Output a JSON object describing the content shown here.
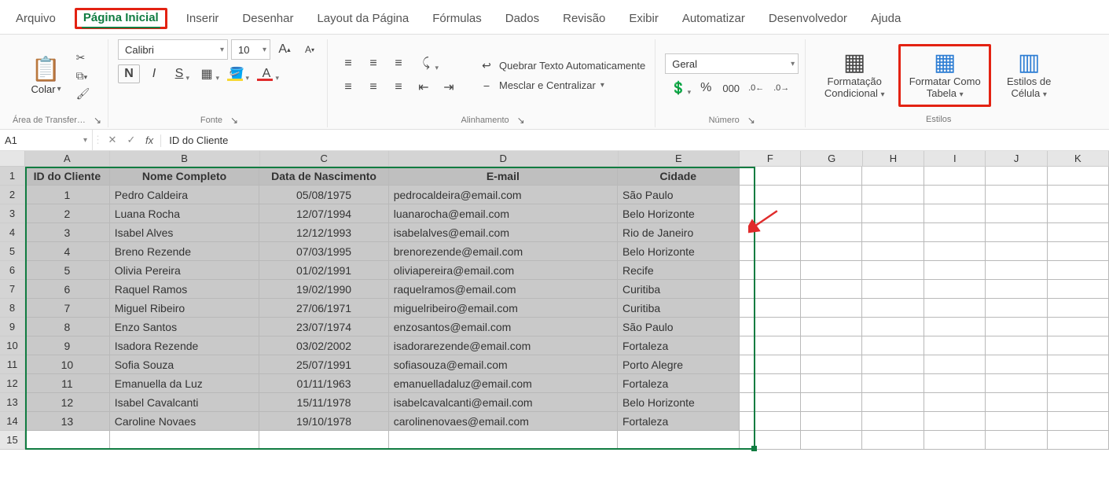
{
  "tabs": {
    "file": "Arquivo",
    "home": "Página Inicial",
    "insert": "Inserir",
    "draw": "Desenhar",
    "pagelayout": "Layout da Página",
    "formulas": "Fórmulas",
    "data": "Dados",
    "review": "Revisão",
    "view": "Exibir",
    "automate": "Automatizar",
    "developer": "Desenvolvedor",
    "help": "Ajuda"
  },
  "ribbon": {
    "clipboard": {
      "paste": "Colar",
      "group_label": "Área de Transfer…"
    },
    "font": {
      "name": "Calibri",
      "size": "10",
      "group_label": "Fonte",
      "bold": "N",
      "italic": "I",
      "underline": "S",
      "grow": "A",
      "shrink": "A"
    },
    "alignment": {
      "group_label": "Alinhamento",
      "wrap": "Quebrar Texto Automaticamente",
      "merge": "Mesclar e Centralizar"
    },
    "number": {
      "format": "Geral",
      "group_label": "Número"
    },
    "styles": {
      "group_label": "Estilos",
      "cond": "Formatação Condicional",
      "table": "Formatar Como Tabela",
      "cell": "Estilos de Célula"
    }
  },
  "formula_bar": {
    "name_box": "A1",
    "content": "ID do Cliente"
  },
  "columns": [
    "A",
    "B",
    "C",
    "D",
    "E",
    "F",
    "G",
    "H",
    "I",
    "J",
    "K"
  ],
  "headers": [
    "ID do Cliente",
    "Nome Completo",
    "Data de Nascimento",
    "E-mail",
    "Cidade"
  ],
  "rows": [
    [
      "1",
      "Pedro Caldeira",
      "05/08/1975",
      "pedrocaldeira@email.com",
      "São Paulo"
    ],
    [
      "2",
      "Luana Rocha",
      "12/07/1994",
      "luanarocha@email.com",
      "Belo Horizonte"
    ],
    [
      "3",
      "Isabel Alves",
      "12/12/1993",
      "isabelalves@email.com",
      "Rio de Janeiro"
    ],
    [
      "4",
      "Breno Rezende",
      "07/03/1995",
      "brenorezende@email.com",
      "Belo Horizonte"
    ],
    [
      "5",
      "Olivia Pereira",
      "01/02/1991",
      "oliviapereira@email.com",
      "Recife"
    ],
    [
      "6",
      "Raquel Ramos",
      "19/02/1990",
      "raquelramos@email.com",
      "Curitiba"
    ],
    [
      "7",
      "Miguel Ribeiro",
      "27/06/1971",
      "miguelribeiro@email.com",
      "Curitiba"
    ],
    [
      "8",
      "Enzo Santos",
      "23/07/1974",
      "enzosantos@email.com",
      "São Paulo"
    ],
    [
      "9",
      "Isadora Rezende",
      "03/02/2002",
      "isadorarezende@email.com",
      "Fortaleza"
    ],
    [
      "10",
      "Sofia Souza",
      "25/07/1991",
      "sofiasouza@email.com",
      "Porto Alegre"
    ],
    [
      "11",
      "Emanuella da Luz",
      "01/11/1963",
      "emanuelladaluz@email.com",
      "Fortaleza"
    ],
    [
      "12",
      "Isabel Cavalcanti",
      "15/11/1978",
      "isabelcavalcanti@email.com",
      "Belo Horizonte"
    ],
    [
      "13",
      "Caroline Novaes",
      "19/10/1978",
      "carolinenovaes@email.com",
      "Fortaleza"
    ]
  ]
}
